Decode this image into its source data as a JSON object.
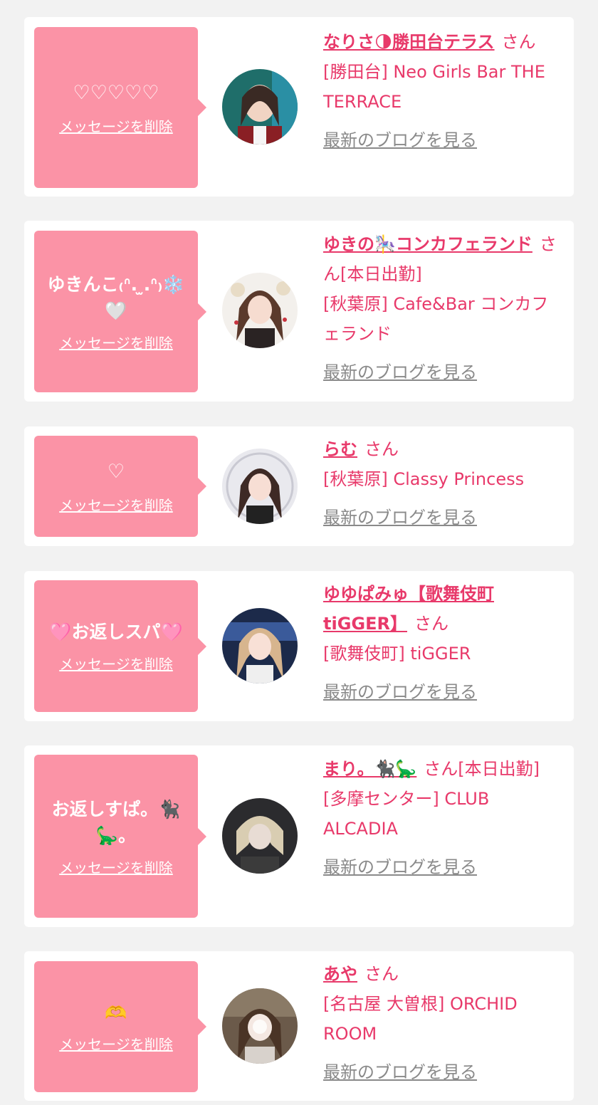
{
  "common": {
    "delete_label": "メッセージを削除",
    "blog_label": "最新のブログを見る",
    "san": "さん"
  },
  "cards": [
    {
      "message": "♡♡♡♡♡",
      "name": "なりさ🌗勝田台テラス",
      "suffix": "さん",
      "shop": "[勝田台] Neo Girls Bar THE TERRACE"
    },
    {
      "message": "ゆきんこ₍ᐢ. ̫.ᐢ₎❄️🤍",
      "name": "ゆきの🎠コンカフェランド",
      "suffix": "さん[本日出勤]",
      "shop": "[秋葉原] Cafe&Bar コンカフェランド"
    },
    {
      "message": "♡",
      "name": "らむ",
      "suffix": "さん",
      "shop": "[秋葉原] Classy Princess"
    },
    {
      "message": "🩷お返しスパ🩷",
      "name": "ゆゆぱみゅ【歌舞伎町tiGGER】",
      "suffix": "さん",
      "shop": "[歌舞伎町] tiGGER"
    },
    {
      "message": "お返しすぱ。🐈‍⬛🦕。",
      "name": "まり。🐈‍⬛🦕",
      "suffix": "さん[本日出勤]",
      "shop": "[多摩センター] CLUB ALCADIA"
    },
    {
      "message": "🫶",
      "name": "あや",
      "suffix": "さん",
      "shop": "[名古屋 大曽根] ORCHID ROOM"
    }
  ],
  "colors": {
    "bubble": "#fb93a6",
    "accent": "#e8396a",
    "muted": "#8a8a8a",
    "background": "#f2f2f2"
  }
}
